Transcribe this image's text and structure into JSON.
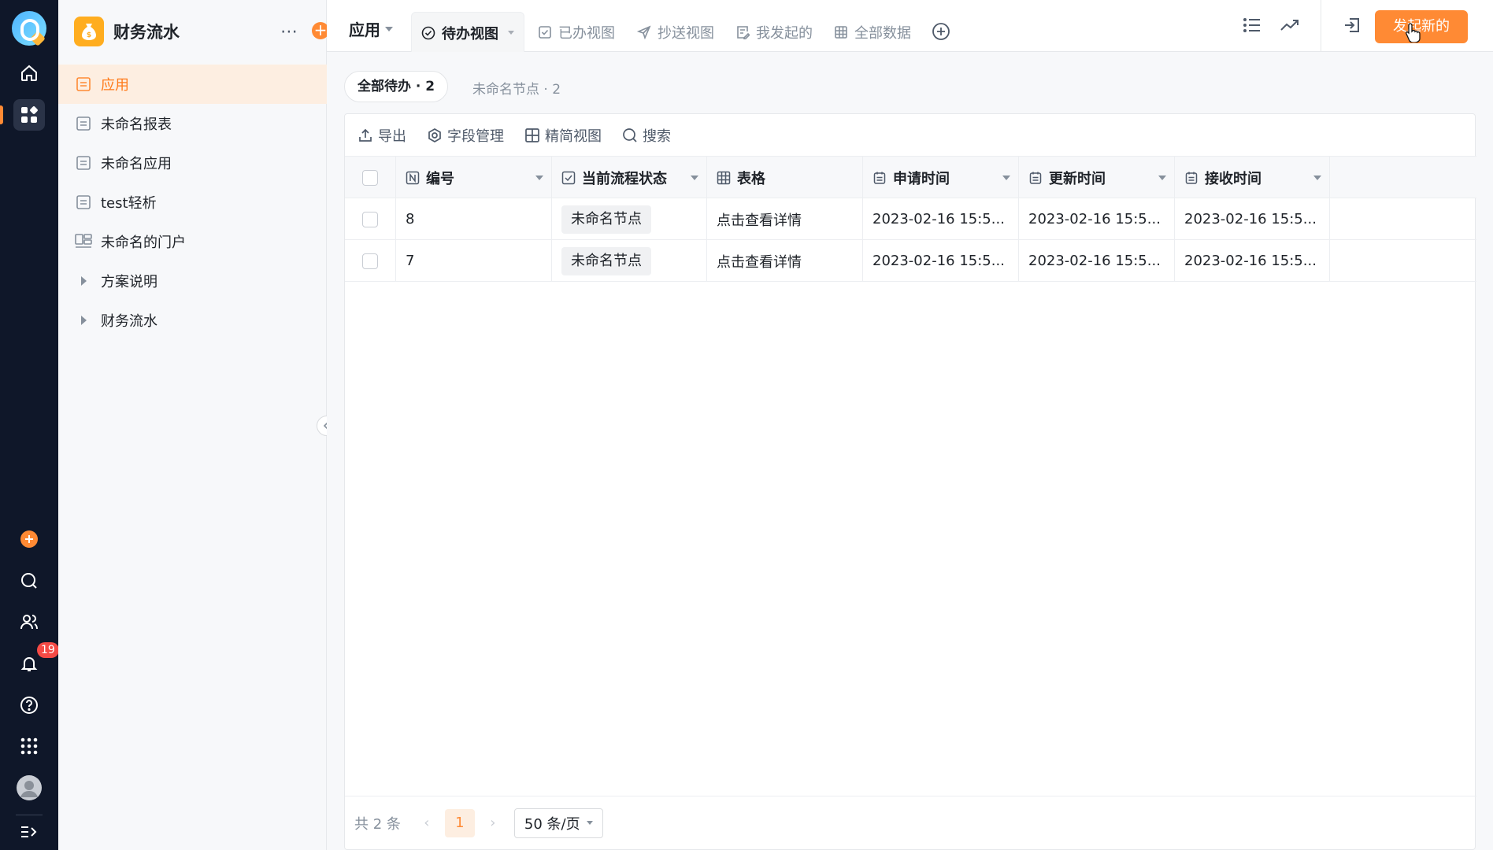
{
  "sidebar": {
    "app_title": "财务流水",
    "items": [
      {
        "label": "应用",
        "active": true
      },
      {
        "label": "未命名报表"
      },
      {
        "label": "未命名应用"
      },
      {
        "label": "test轻析"
      },
      {
        "label": "未命名的门户"
      },
      {
        "label": "方案说明",
        "folder": true
      },
      {
        "label": "财务流水",
        "folder": true
      }
    ]
  },
  "rail": {
    "notification_count": "19"
  },
  "topbar": {
    "app_menu": "应用",
    "tabs": [
      "待办视图",
      "已办视图",
      "抄送视图",
      "我发起的",
      "全部数据"
    ],
    "primary_button": "发起新的"
  },
  "filters": {
    "all": "全部待办 · 2",
    "node": "未命名节点 · 2"
  },
  "toolbar": {
    "export": "导出",
    "fields": "字段管理",
    "compact": "精简视图",
    "search": "搜索"
  },
  "table": {
    "headers": [
      "编号",
      "当前流程状态",
      "表格",
      "申请时间",
      "更新时间",
      "接收时间"
    ],
    "rows": [
      {
        "id": "8",
        "status": "未命名节点",
        "form": "点击查看详情",
        "applied": "2023-02-16 15:5...",
        "updated": "2023-02-16 15:5...",
        "received": "2023-02-16 15:5..."
      },
      {
        "id": "7",
        "status": "未命名节点",
        "form": "点击查看详情",
        "applied": "2023-02-16 15:5...",
        "updated": "2023-02-16 15:5...",
        "received": "2023-02-16 15:5..."
      }
    ]
  },
  "pager": {
    "total": "共 2 条",
    "page": "1",
    "page_size": "50 条/页"
  },
  "colors": {
    "accent": "#ff8a34",
    "rail": "#0f1729"
  }
}
